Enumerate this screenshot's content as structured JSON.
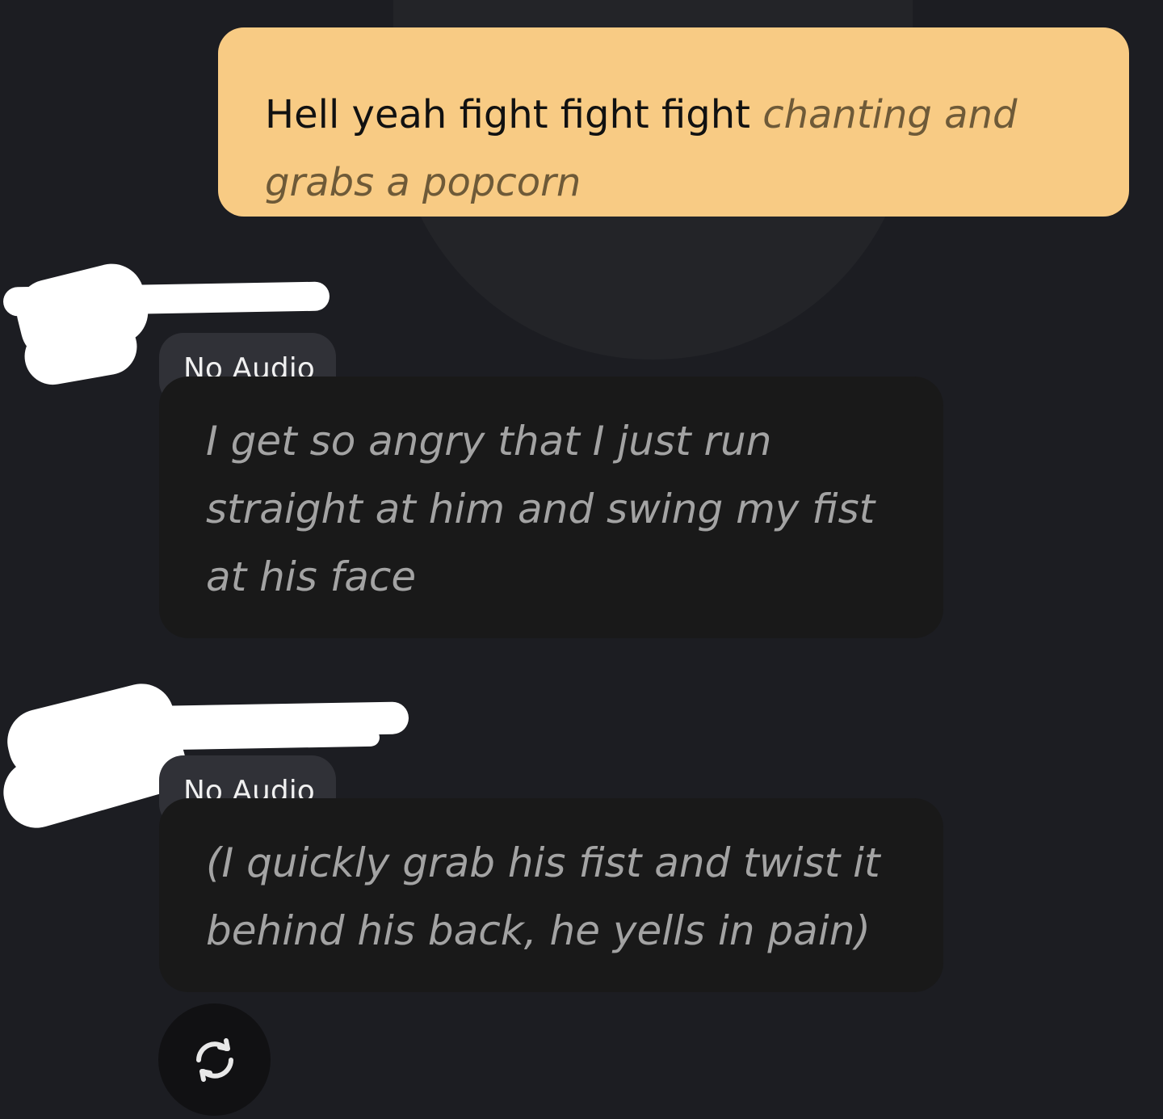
{
  "conversation": {
    "user_message": {
      "text": "Hell yeah fight fight fight ",
      "action": "chanting and grabs a popcorn"
    },
    "bot_messages": [
      {
        "audio_label": "No Audio",
        "text": "I get so angry that I just run straight at him and swing my fist at his face"
      },
      {
        "audio_label": "No Audio",
        "text": "(I quickly grab his fist and twist it behind his back, he yells in pain)"
      }
    ]
  },
  "icons": {
    "regenerate": "refresh-icon"
  },
  "colors": {
    "background": "#1c1d22",
    "user_bubble": "#f8cb84",
    "bot_bubble": "#191919",
    "audio_tag": "#303137"
  }
}
